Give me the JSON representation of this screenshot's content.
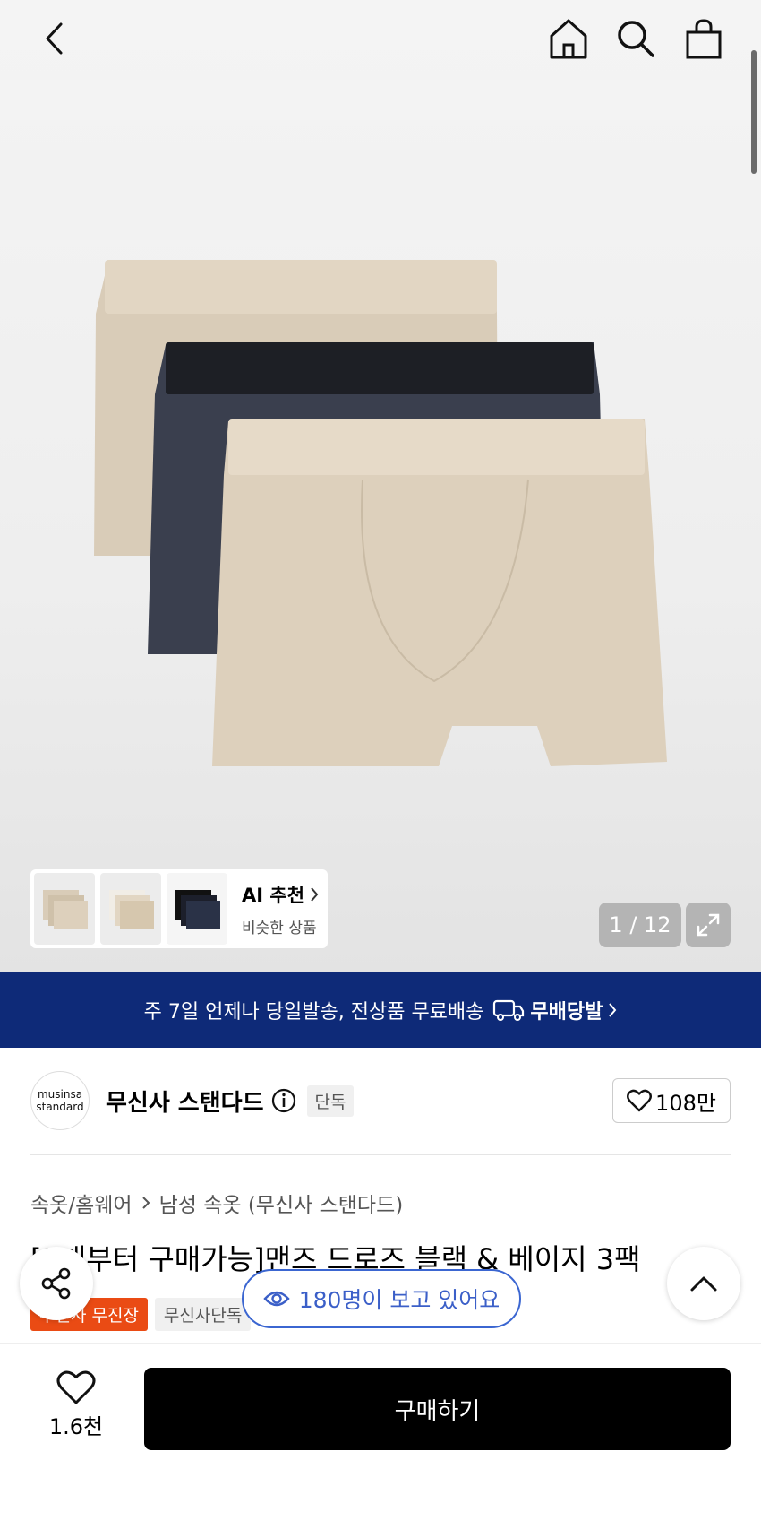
{
  "header": {
    "back_icon": "chevron-left-icon",
    "home_icon": "home-icon",
    "search_icon": "search-icon",
    "cart_icon": "shopping-bag-icon"
  },
  "gallery": {
    "current_page": 1,
    "total_pages": 12,
    "counter_text": "1 / 12",
    "expand_icon": "expand-icon"
  },
  "ai_recommend": {
    "title": "AI 추천",
    "subtitle": "비슷한 상품"
  },
  "banner": {
    "text": "주 7일 언제나 당일발송, 전상품 무료배송",
    "brand_badge": "무배당발",
    "color": "#0e2a78"
  },
  "brand": {
    "logo_line1": "musinsa",
    "logo_line2": "standard",
    "name": "무신사 스탠다드",
    "exclusive_tag": "단독",
    "likes": "108만"
  },
  "breadcrumb": {
    "level1": "속옷/홈웨어",
    "level2": "남성 속옷 (무신사 스탠다드)"
  },
  "product": {
    "title": "[2개부터 구매가능]맨즈 드로즈 블랙 & 베이지 3팩",
    "tag_red": "무신사 무진장",
    "tag_gray": "무신사단독"
  },
  "viewers": {
    "text": "180명이 보고 있어요"
  },
  "bottom": {
    "wish_count": "1.6천",
    "buy_label": "구매하기"
  },
  "colors": {
    "accent_blue": "#3b66d1",
    "tag_red": "#ea4b14",
    "buy_button": "#000000"
  }
}
